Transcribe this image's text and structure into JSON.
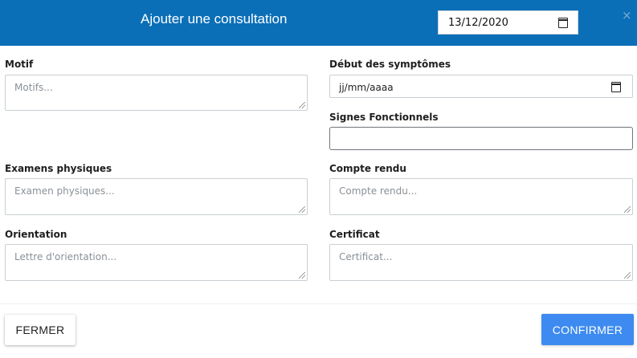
{
  "header": {
    "title": "Ajouter une consultation",
    "date_value": "13/12/2020",
    "close_symbol": "×"
  },
  "form": {
    "motif": {
      "label": "Motif",
      "placeholder": "Motifs..."
    },
    "debut_symptomes": {
      "label": "Début des symptômes",
      "value": "jj/mm/aaaa"
    },
    "signes_fonctionnels": {
      "label": "Signes Fonctionnels",
      "value": ""
    },
    "examens_physiques": {
      "label": "Examens physiques",
      "placeholder": "Examen physiques..."
    },
    "compte_rendu": {
      "label": "Compte rendu",
      "placeholder": "Compte rendu..."
    },
    "orientation": {
      "label": "Orientation",
      "placeholder": "Lettre d'orientation..."
    },
    "certificat": {
      "label": "Certificat",
      "placeholder": "Certificat..."
    }
  },
  "footer": {
    "fermer_label": "FERMER",
    "confirmer_label": "CONFIRMER"
  },
  "colors": {
    "header_bg": "#0b6fb8",
    "confirm_bg": "#3d8bf0"
  },
  "icons": {
    "calendar": "calendar-icon",
    "close": "close-icon",
    "resize": "resize-handle-icon"
  }
}
